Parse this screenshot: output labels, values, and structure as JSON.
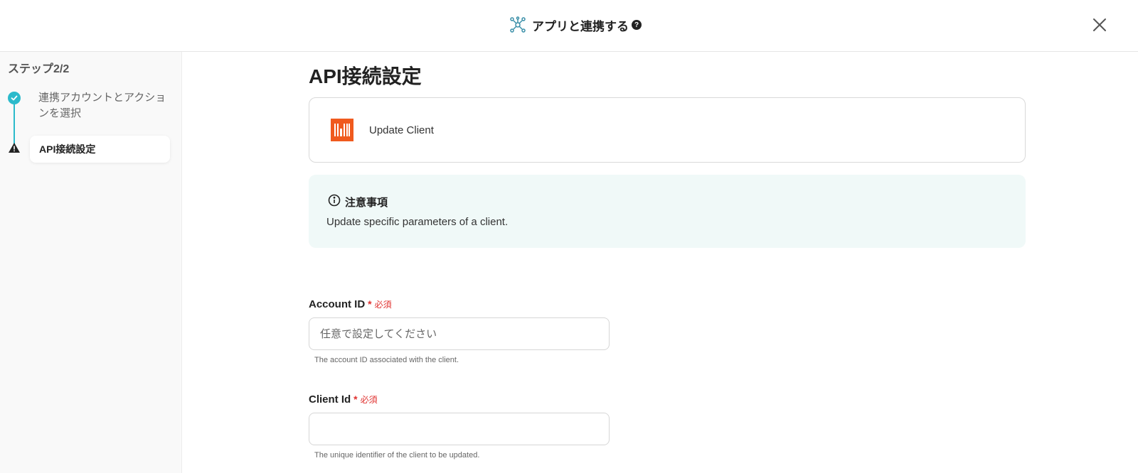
{
  "header": {
    "title": "アプリと連携する",
    "help_icon": "?",
    "close_icon": "close-icon"
  },
  "sidebar": {
    "step_heading": "ステップ2/2",
    "steps": [
      {
        "label": "連携アカウントとアクションを選択",
        "status": "completed"
      },
      {
        "label": "API接続設定",
        "status": "warning"
      }
    ]
  },
  "main": {
    "title": "API接続設定",
    "action_card": {
      "name": "Update Client",
      "logo_color": "#f05a1e"
    },
    "notice": {
      "heading": "注意事項",
      "body": "Update specific parameters of a client."
    },
    "fields": [
      {
        "label": "Account ID",
        "required_label": "必須",
        "placeholder": "任意で設定してください",
        "value": "",
        "hint": "The account ID associated with the client."
      },
      {
        "label": "Client Id",
        "required_label": "必須",
        "placeholder": "",
        "value": "",
        "hint": "The unique identifier of the client to be updated."
      }
    ]
  },
  "colors": {
    "accent": "#2bbacb",
    "required": "#e0312f",
    "notice_bg": "#f0f9f8"
  }
}
